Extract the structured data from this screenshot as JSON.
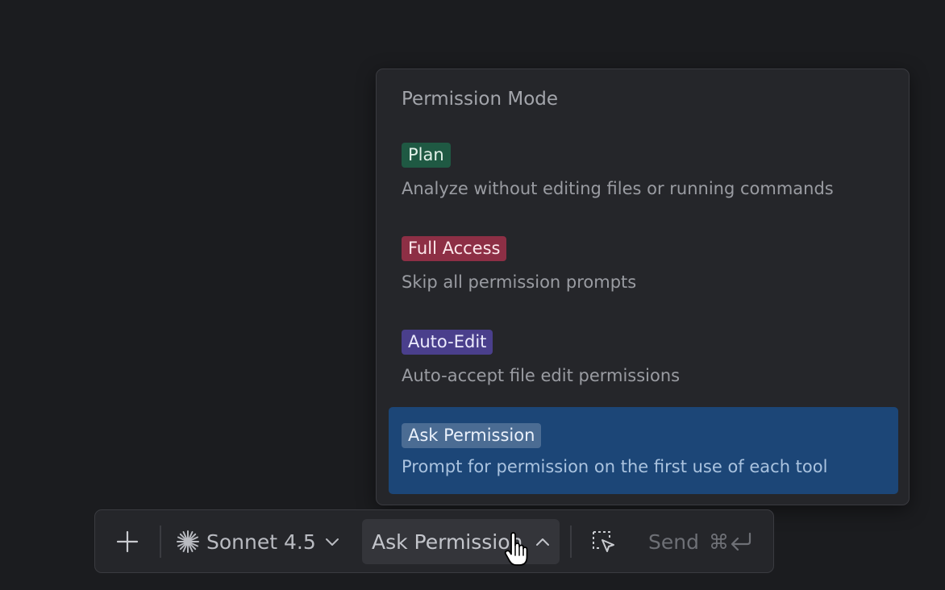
{
  "menu": {
    "title": "Permission Mode",
    "items": [
      {
        "badge": "Plan",
        "description": "Analyze without editing files or running commands",
        "badge_color": "#1f5943",
        "selected": false
      },
      {
        "badge": "Full Access",
        "description": "Skip all permission prompts",
        "badge_color": "#8d2f45",
        "selected": false
      },
      {
        "badge": "Auto-Edit",
        "description": "Auto-accept file edit permissions",
        "badge_color": "#4a3f8c",
        "selected": false
      },
      {
        "badge": "Ask Permission",
        "description": "Prompt for permission on the first use of each tool",
        "badge_color": "#4b6c93",
        "selected": true
      }
    ],
    "selected_color": "#1c4677"
  },
  "toolbar": {
    "add_icon": "plus-icon",
    "model_icon": "sparkle-icon",
    "model_label": "Sonnet 4.5",
    "model_chevron_icon": "chevron-down-icon",
    "permission_label": "Ask Permission",
    "permission_chevron_icon": "chevron-up-icon",
    "select_icon": "select-element-icon",
    "send_label": "Send",
    "send_shortcut": "⌘",
    "send_shortcut_icon": "return-icon"
  },
  "cursor_icon": "hand-pointer-icon"
}
